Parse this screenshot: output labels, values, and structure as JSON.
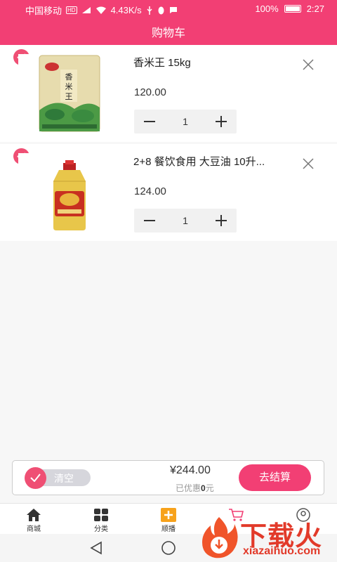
{
  "status_bar": {
    "carrier": "中国移动",
    "network_badge": "HD",
    "speed": "4.43K/s",
    "battery": "100%",
    "time": "2:27"
  },
  "header": {
    "title": "购物车"
  },
  "cart": {
    "items": [
      {
        "name": "香米王 15kg",
        "price": "120.00",
        "quantity": "1",
        "checked": true,
        "image": "rice-bag"
      },
      {
        "name": "2+8 餐饮食用 大豆油 10升...",
        "price": "124.00",
        "quantity": "1",
        "checked": true,
        "image": "oil-bottle"
      }
    ]
  },
  "checkout": {
    "clear_label": "清空",
    "total": "¥244.00",
    "discount_prefix": "已优惠",
    "discount_value": "0",
    "discount_suffix": "元",
    "checkout_label": "去结算"
  },
  "tabs": [
    {
      "label": "商城",
      "icon": "home-icon"
    },
    {
      "label": "分类",
      "icon": "grid-icon"
    },
    {
      "label": "顺播",
      "icon": "plus-box-icon"
    },
    {
      "label": "",
      "icon": "cart-icon"
    },
    {
      "label": "",
      "icon": "user-icon"
    }
  ],
  "watermark": {
    "text": "下载火",
    "url": "xiazaihuo.com"
  },
  "colors": {
    "accent": "#f23f74",
    "check": "#ef4f74",
    "stepper_bg": "#f1f1f1"
  }
}
